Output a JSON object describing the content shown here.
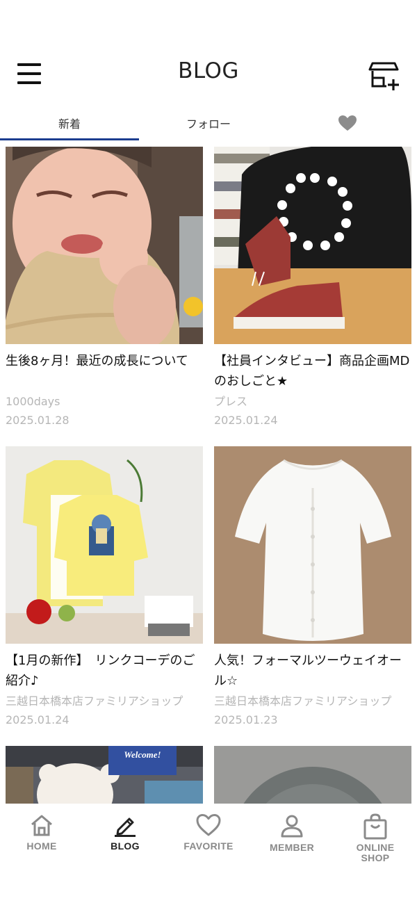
{
  "header": {
    "title": "BLOG",
    "menu_icon": "hamburger-menu-icon",
    "store_icon": "store-add-icon"
  },
  "tabs": [
    {
      "label": "新着",
      "active": true
    },
    {
      "label": "フォロー",
      "active": false
    },
    {
      "label": "",
      "icon": "heart-icon",
      "active": false
    }
  ],
  "posts": [
    {
      "title": "生後8ヶ月！最近の成長について",
      "author": "1000days",
      "date": "2025.01.28",
      "image": "crying baby in bib"
    },
    {
      "title": "【社員インタビュー】商品企画MDのおしごと★",
      "author": "プレス",
      "date": "2025.01.24",
      "image": "red plaid sneakers"
    },
    {
      "title": "【1月の新作】　リンクコーデのご紹介♪",
      "author": "三越日本橋本店ファミリアショップ",
      "date": "2025.01.24",
      "image": "yellow baby clothes display"
    },
    {
      "title": "人気！フォーマルツーウェイオール☆",
      "author": "三越日本橋本店ファミリアショップ",
      "date": "2025.01.23",
      "image": "white formal baby gown"
    },
    {
      "title": "",
      "author": "",
      "date": "",
      "image": "bear and Welcome sign",
      "sign_text": "Welcome!"
    },
    {
      "title": "",
      "author": "",
      "date": "",
      "image": "grey plate"
    }
  ],
  "bottom_nav": [
    {
      "label": "HOME",
      "icon": "home-icon",
      "active": false
    },
    {
      "label": "BLOG",
      "icon": "pencil-icon",
      "active": true
    },
    {
      "label": "FAVORITE",
      "icon": "heart-icon",
      "active": false
    },
    {
      "label": "MEMBER",
      "icon": "person-icon",
      "active": false
    },
    {
      "label": "ONLINE SHOP",
      "icon": "shopping-bag-icon",
      "active": false
    }
  ],
  "colors": {
    "accent": "#1c3d8f",
    "muted_text": "#b6b6b6",
    "inactive_nav": "#8a8a8a"
  }
}
